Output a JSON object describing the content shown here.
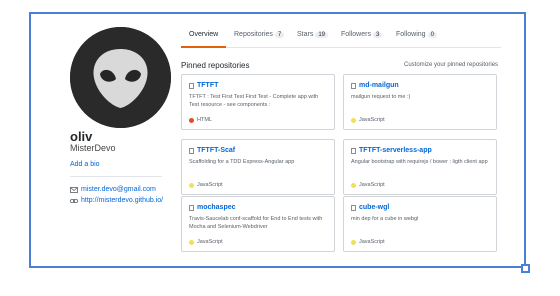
{
  "profile": {
    "name": "oliv",
    "login": "MisterDevo",
    "bio_link": "Add a bio",
    "email": "mister.devo@gmail.com",
    "website": "http://misterdevo.github.io/"
  },
  "tabs": [
    {
      "label": "Overview",
      "count": ""
    },
    {
      "label": "Repositories",
      "count": "7"
    },
    {
      "label": "Stars",
      "count": "19"
    },
    {
      "label": "Followers",
      "count": "3"
    },
    {
      "label": "Following",
      "count": "0"
    }
  ],
  "pinned": {
    "heading": "Pinned repositories",
    "customize": "Customize your pinned repositories",
    "repos": [
      {
        "name": "TFTFT",
        "desc": "TFTFT : Test First Test First Test - Complete app with Test resource - see components :",
        "lang": "HTML",
        "lang_color": "#e34c26"
      },
      {
        "name": "md-mailgun",
        "desc": "mailgun request to me :)",
        "lang": "JavaScript",
        "lang_color": "#f1e05a"
      },
      {
        "name": "TFTFT-Scaf",
        "desc": "Scaffolding for a TDD Express-Angular app",
        "lang": "JavaScript",
        "lang_color": "#f1e05a"
      },
      {
        "name": "TFTFT-serverless-app",
        "desc": "Angular bootstrap with requirejs / bower : ligth client app",
        "lang": "JavaScript",
        "lang_color": "#f1e05a"
      },
      {
        "name": "mochaspec",
        "desc": "Travis-Saucelab conf-scaffold for End to End tests with Mocha and Selenium-Webdriver",
        "lang": "JavaScript",
        "lang_color": "#f1e05a"
      },
      {
        "name": "cube-wgl",
        "desc": "min dep for a cube in webgl",
        "lang": "JavaScript",
        "lang_color": "#f1e05a"
      }
    ]
  },
  "colors": {
    "accent": "#0366d6",
    "tab_underline": "#e36209",
    "frame": "#4a7fd6"
  },
  "icons": {
    "email": "mail-icon",
    "website": "link-icon",
    "repo": "repo-icon"
  }
}
